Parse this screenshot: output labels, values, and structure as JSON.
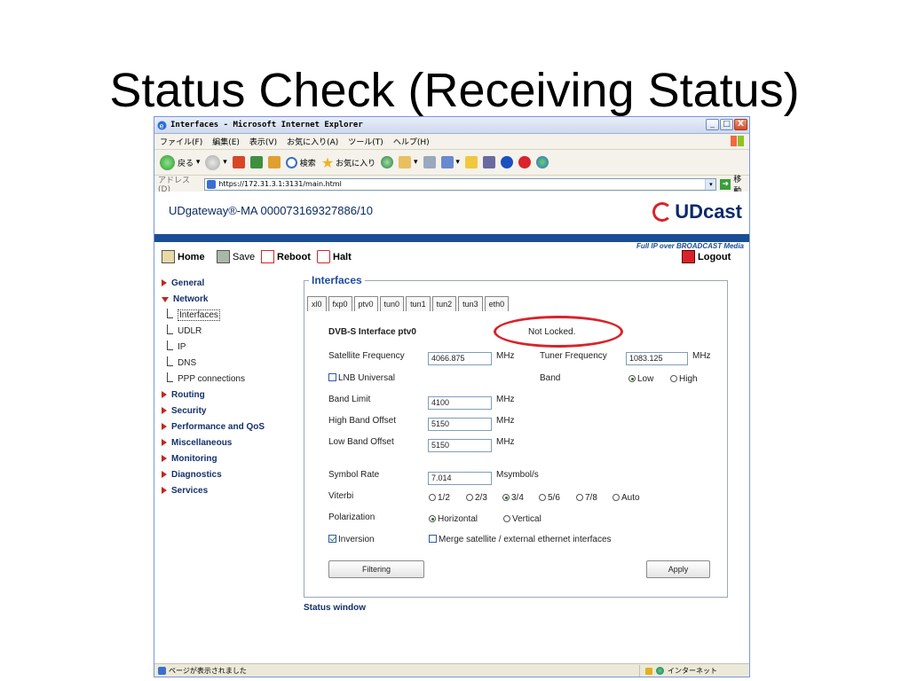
{
  "slide": {
    "title": "Status Check (Receiving Status)"
  },
  "window": {
    "title": "Interfaces - Microsoft Internet Explorer",
    "min": "_",
    "max": "□",
    "close": "X"
  },
  "menu": [
    "ファイル(F)",
    "編集(E)",
    "表示(V)",
    "お気に入り(A)",
    "ツール(T)",
    "ヘルプ(H)"
  ],
  "toolbar": {
    "back": "戻る",
    "search": "検索",
    "favorites": "お気に入り"
  },
  "address": {
    "label": "アドレス(D)",
    "url": "https://172.31.3.1:3131/main.html",
    "go": "移動"
  },
  "header": {
    "device": "UDgateway®-MA  000073169327886/10",
    "brand": "UDcast",
    "tagline": "Full IP over BROADCAST Media"
  },
  "actions": {
    "home": "Home",
    "save": "Save",
    "reboot": "Reboot",
    "halt": "Halt",
    "logout": "Logout"
  },
  "sidebar": {
    "general": "General",
    "network": "Network",
    "sub": [
      "Interfaces",
      "UDLR",
      "IP",
      "DNS",
      "PPP connections"
    ],
    "rest": [
      "Routing",
      "Security",
      "Performance and QoS",
      "Miscellaneous",
      "Monitoring",
      "Diagnostics",
      "Services"
    ]
  },
  "panel": {
    "legend": "Interfaces",
    "tabs": [
      "xl0",
      "fxp0",
      "ptv0",
      "tun0",
      "tun1",
      "tun2",
      "tun3",
      "eth0"
    ],
    "iface_title": "DVB-S Interface ptv0",
    "lock_status": "Not Locked.",
    "sat_freq_label": "Satellite Frequency",
    "sat_freq": "4066.875",
    "mhz": "MHz",
    "tuner_freq_label": "Tuner Frequency",
    "tuner_freq": "1083.125",
    "lnb": "LNB Universal",
    "band_label": "Band",
    "band_low": "Low",
    "band_high": "High",
    "band_limit_label": "Band Limit",
    "band_limit": "4100",
    "high_offset_label": "High Band Offset",
    "high_offset": "5150",
    "low_offset_label": "Low Band Offset",
    "low_offset": "5150",
    "symbol_rate_label": "Symbol Rate",
    "symbol_rate": "7.014",
    "msymbol": "Msymbol/s",
    "viterbi_label": "Viterbi",
    "viterbi": [
      "1/2",
      "2/3",
      "3/4",
      "5/6",
      "7/8",
      "Auto"
    ],
    "polarization_label": "Polarization",
    "pol_h": "Horizontal",
    "pol_v": "Vertical",
    "inversion": "Inversion",
    "merge": "Merge satellite / external ethernet interfaces",
    "filtering": "Filtering",
    "apply": "Apply"
  },
  "status_window": "Status window",
  "statusbar": {
    "left": "ページが表示されました",
    "zone": "インターネット"
  }
}
